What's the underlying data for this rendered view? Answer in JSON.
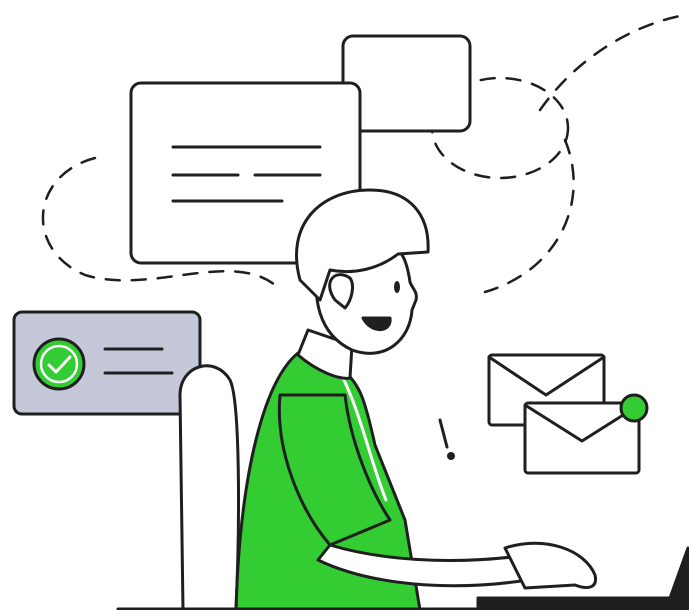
{
  "illustration": {
    "palette": {
      "outline": "#1f1f1f",
      "shirt_green": "#33cc33",
      "notification_dot": "#33cc33",
      "check_badge": "#33cc33",
      "card_fill": "#c5c8d8",
      "background": "#ffffff"
    },
    "elements": {
      "document_card": "document-card",
      "small_card": "small-card",
      "success_card": "success-card",
      "check_icon": "check-circle-icon",
      "envelopes": [
        "mail-envelope-icon",
        "mail-envelope-icon"
      ],
      "notification_dot": "notification-dot",
      "alert_mark": "exclamation-icon",
      "person": "person-at-laptop",
      "chair": "chair",
      "laptop": "laptop"
    }
  }
}
